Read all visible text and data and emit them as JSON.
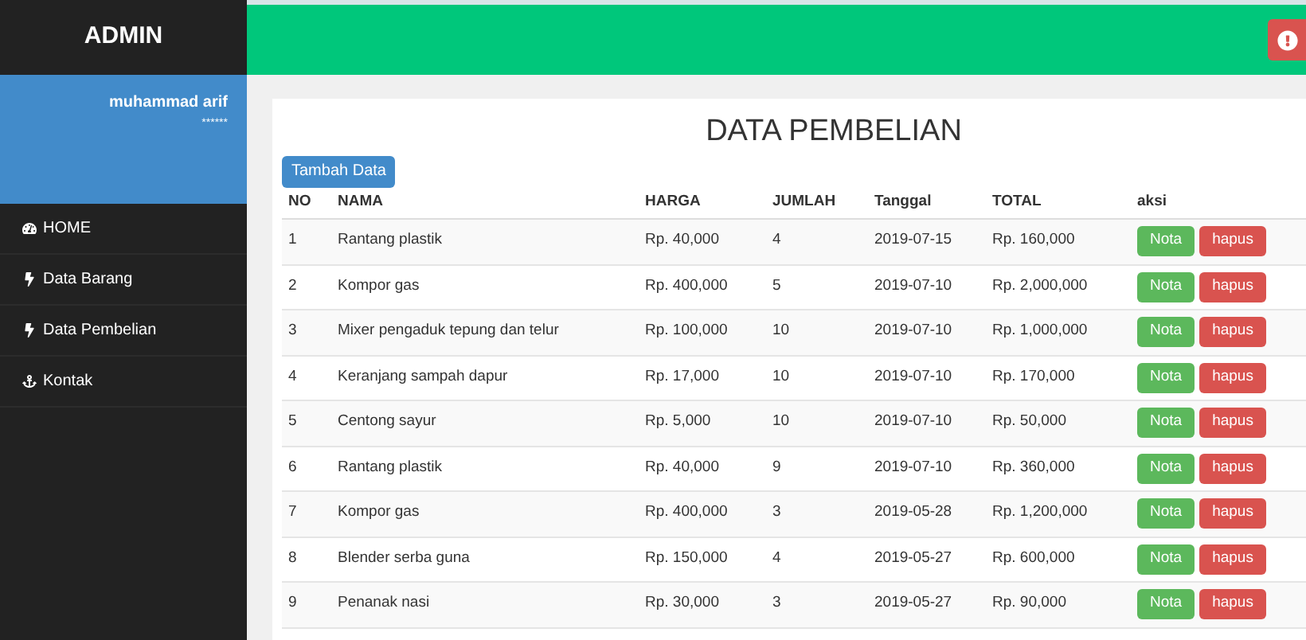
{
  "sidebar": {
    "brand": "ADMIN",
    "user": {
      "name": "muhammad arif",
      "subtitle": "******"
    },
    "items": [
      {
        "label": "HOME"
      },
      {
        "label": "Data Barang"
      },
      {
        "label": "Data Pembelian"
      },
      {
        "label": "Kontak"
      }
    ]
  },
  "page": {
    "title": "DATA PEMBELIAN",
    "add_button": "Tambah Data"
  },
  "table": {
    "columns": [
      "NO",
      "NAMA",
      "HARGA",
      "JUMLAH",
      "Tanggal",
      "TOTAL",
      "aksi"
    ],
    "rows": [
      {
        "cells": [
          "1",
          "Rantang plastik",
          "Rp. 40,000",
          "4",
          "2019-07-15",
          "Rp. 160,000"
        ],
        "actions": [
          "Nota",
          "hapus"
        ]
      },
      {
        "cells": [
          "2",
          "Kompor gas",
          "Rp. 400,000",
          "5",
          "2019-07-10",
          "Rp. 2,000,000"
        ],
        "actions": [
          "Nota",
          "hapus"
        ]
      },
      {
        "cells": [
          "3",
          "Mixer pengaduk tepung dan telur",
          "Rp. 100,000",
          "10",
          "2019-07-10",
          "Rp. 1,000,000"
        ],
        "actions": [
          "Nota",
          "hapus"
        ]
      },
      {
        "cells": [
          "4",
          "Keranjang sampah dapur",
          "Rp. 17,000",
          "10",
          "2019-07-10",
          "Rp. 170,000"
        ],
        "actions": [
          "Nota",
          "hapus"
        ]
      },
      {
        "cells": [
          "5",
          "Centong sayur",
          "Rp. 5,000",
          "10",
          "2019-07-10",
          "Rp. 50,000"
        ],
        "actions": [
          "Nota",
          "hapus"
        ]
      },
      {
        "cells": [
          "6",
          "Rantang plastik",
          "Rp. 40,000",
          "9",
          "2019-07-10",
          "Rp. 360,000"
        ],
        "actions": [
          "Nota",
          "hapus"
        ]
      },
      {
        "cells": [
          "7",
          "Kompor gas",
          "Rp. 400,000",
          "3",
          "2019-05-28",
          "Rp. 1,200,000"
        ],
        "actions": [
          "Nota",
          "hapus"
        ]
      },
      {
        "cells": [
          "8",
          "Blender serba guna",
          "Rp. 150,000",
          "4",
          "2019-05-27",
          "Rp. 600,000"
        ],
        "actions": [
          "Nota",
          "hapus"
        ]
      },
      {
        "cells": [
          "9",
          "Penanak nasi",
          "Rp. 30,000",
          "3",
          "2019-05-27",
          "Rp. 90,000"
        ],
        "actions": [
          "Nota",
          "hapus"
        ]
      }
    ]
  }
}
